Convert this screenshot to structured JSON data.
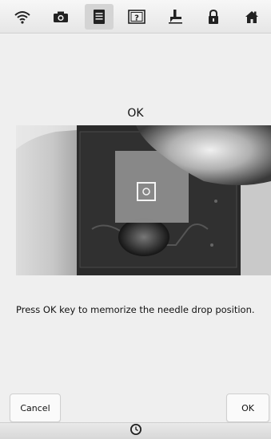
{
  "toolbar": {
    "icons": [
      "wifi-icon",
      "camera-icon",
      "document-icon",
      "help-icon",
      "presser-foot-icon",
      "lock-icon",
      "home-icon"
    ],
    "active_index": 2
  },
  "screen": {
    "title": "OK",
    "instruction": "Press OK key to memorize the needle drop position."
  },
  "buttons": {
    "cancel_label": "Cancel",
    "ok_label": "OK"
  },
  "bottom_bar": {
    "icon": "clock-icon"
  }
}
